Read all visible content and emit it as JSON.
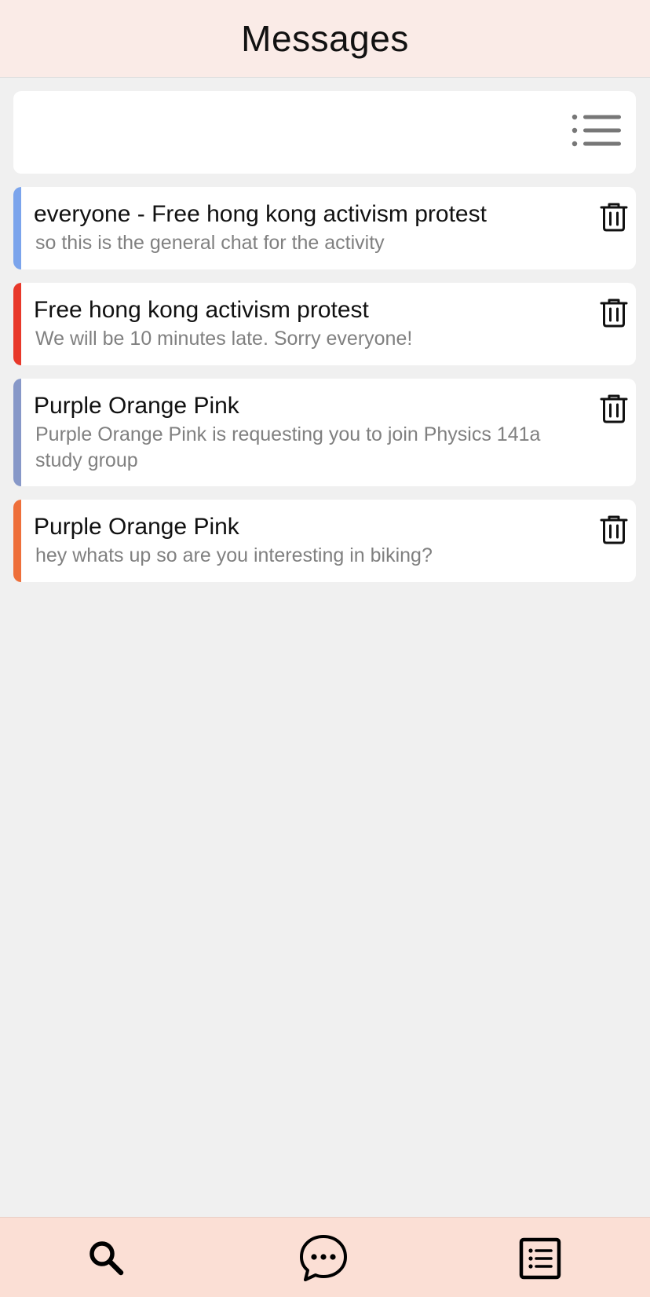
{
  "header": {
    "title": "Messages"
  },
  "filter": {
    "icon": "list-filter-icon"
  },
  "messages": [
    {
      "title": "everyone - Free hong kong activism protest",
      "preview": "so this is the general chat for the activity",
      "color": "#7ba4ec"
    },
    {
      "title": "Free hong kong activism protest",
      "preview": "We will be 10 minutes late. Sorry everyone!",
      "color": "#e8382a"
    },
    {
      "title": "Purple Orange Pink",
      "preview": "Purple Orange Pink is requesting you to join Physics  141a study group",
      "color": "#8798c8"
    },
    {
      "title": "Purple Orange Pink",
      "preview": "hey whats up so are you interesting in biking?",
      "color": "#ee6f3a"
    }
  ],
  "nav": {
    "items": [
      {
        "icon": "search-icon"
      },
      {
        "icon": "chat-bubble-icon"
      },
      {
        "icon": "list-icon"
      }
    ]
  },
  "colors": {
    "header_bg": "#faebe7",
    "nav_bg": "#fbdfd5",
    "page_bg": "#f0f0f0"
  }
}
